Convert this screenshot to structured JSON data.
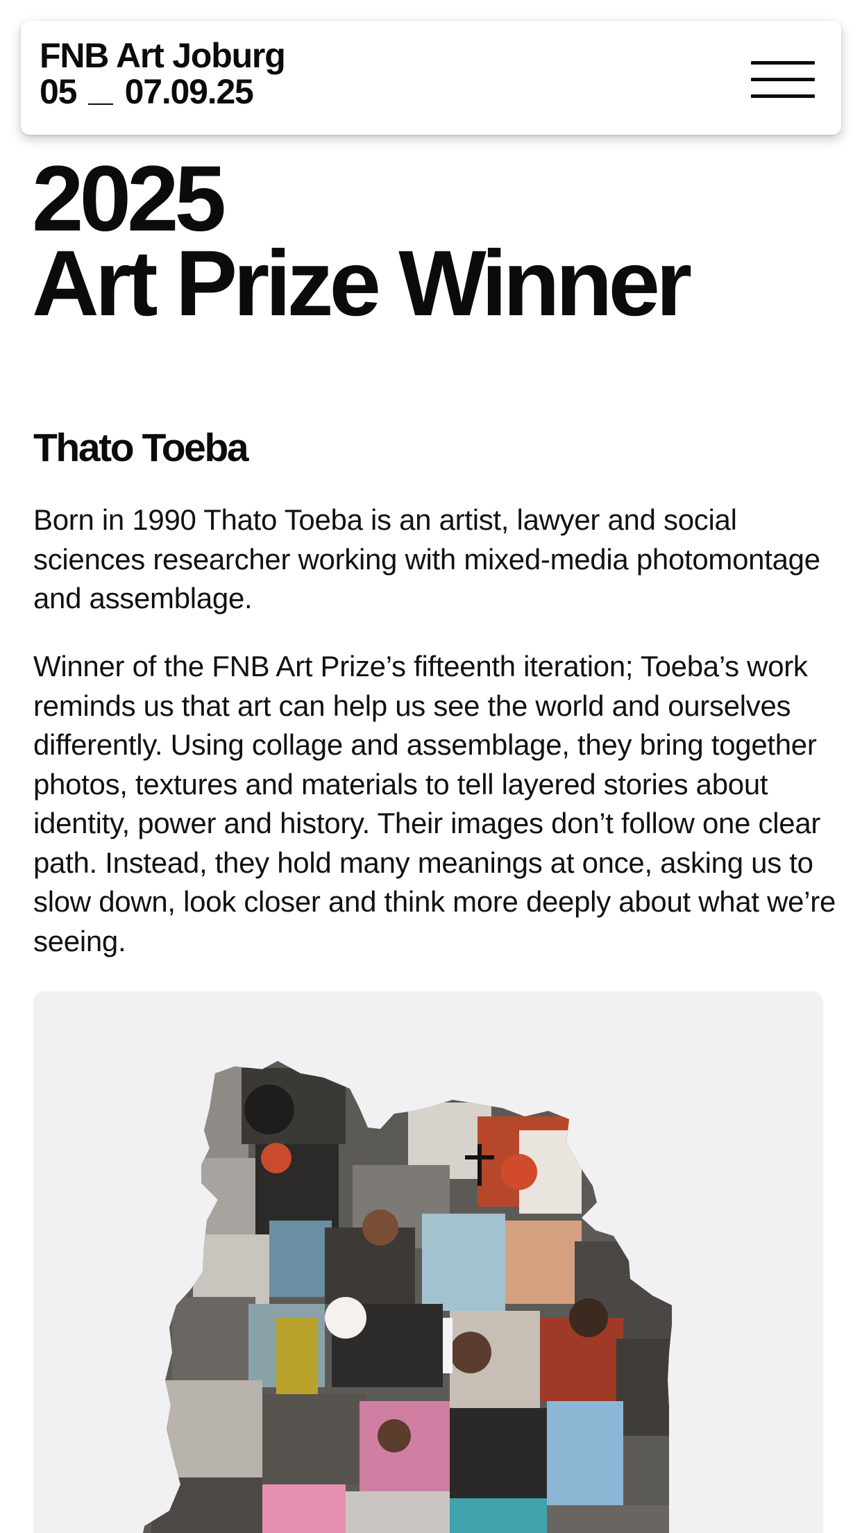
{
  "header": {
    "brand_name": "FNB Art Joburg",
    "date_start": "05",
    "date_end": "07.09.25",
    "menu_icon": "hamburger-menu-icon"
  },
  "main": {
    "title_year": "2025",
    "title_text": "Art Prize Winner",
    "artist_name": "Thato Toeba",
    "paragraphs": [
      "Born in 1990 Thato Toeba is an artist, lawyer and social sciences researcher working with mixed-media photomontage and assemblage.",
      "Winner of the FNB Art Prize’s fifteenth iteration; Toeba’s work reminds us that art can help us see the world and ourselves differently. Using collage and assemblage, they bring together photos, textures and materials to tell layered stories about identity, power and history. Their images don’t follow one clear path. Instead, they hold many meanings at once, asking us to slow down, look closer and think more deeply about what we’re seeing."
    ],
    "artwork": {
      "description_icon": "artwork-collage-image"
    }
  },
  "colors": {
    "text": "#0b0b0b",
    "background": "#ffffff",
    "artwork_background": "#f1f1f3"
  }
}
